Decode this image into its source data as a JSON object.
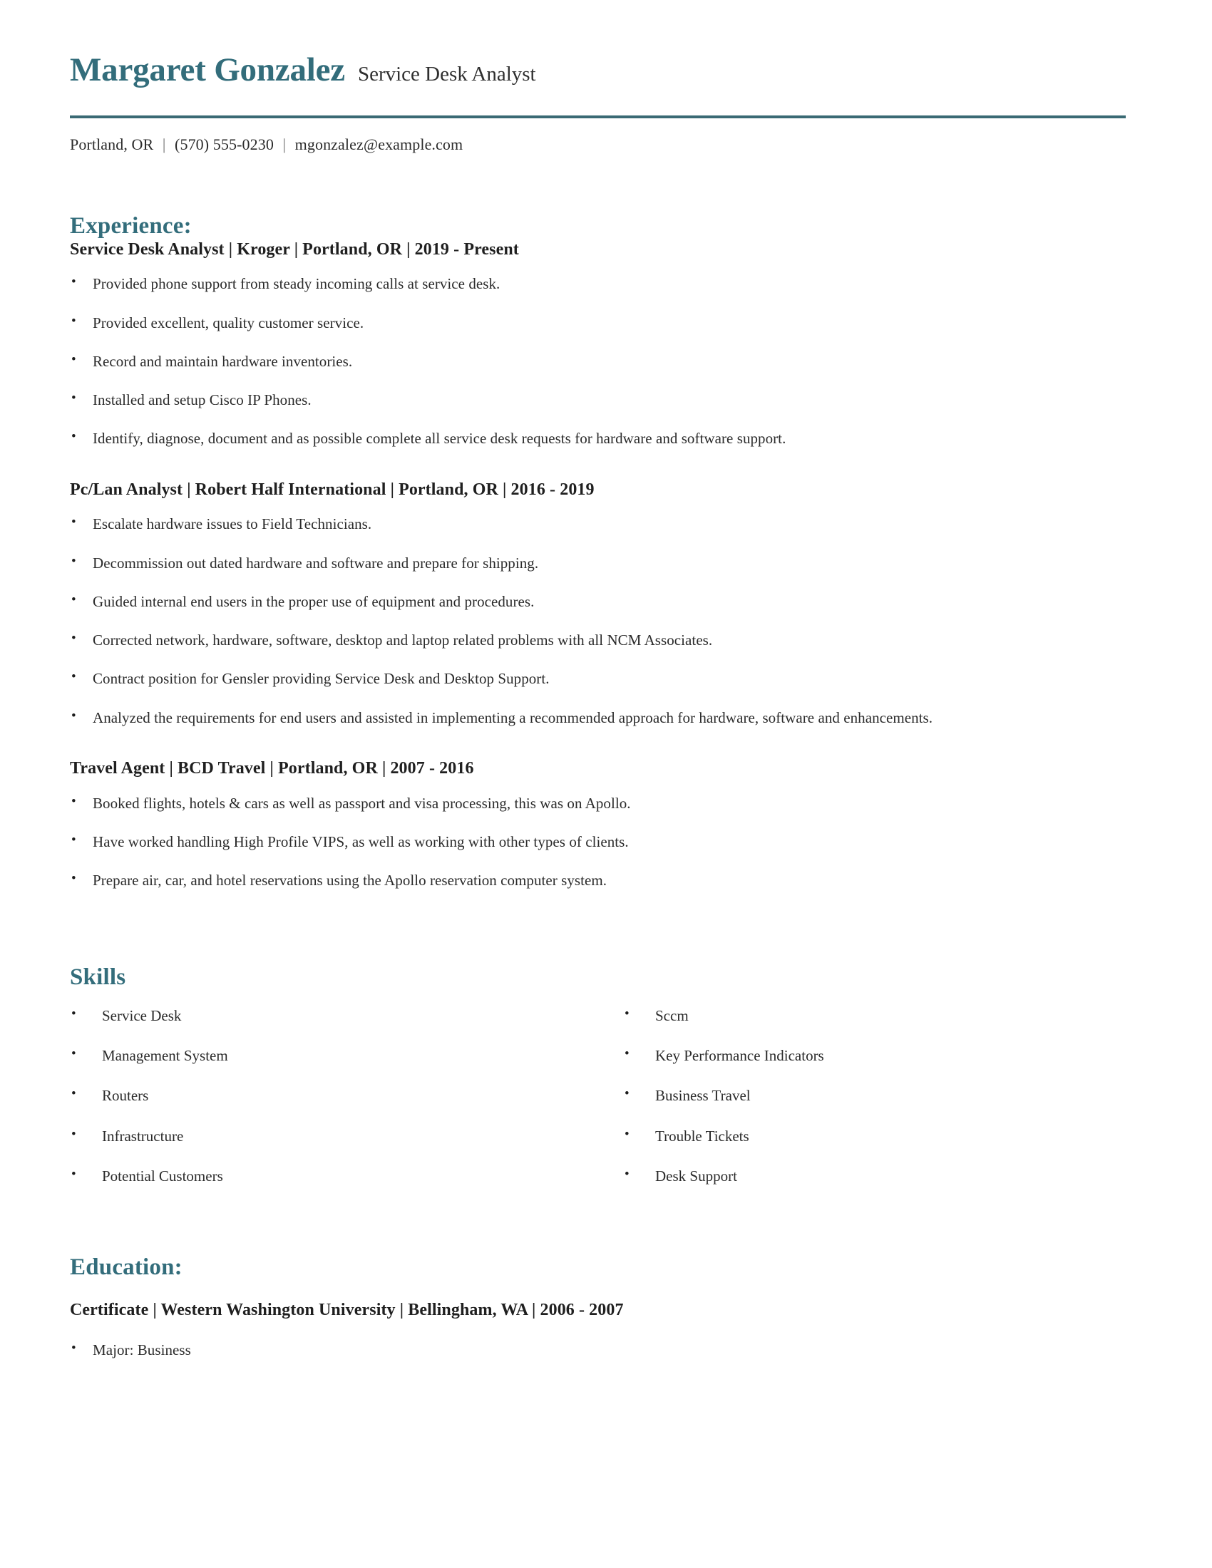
{
  "theme": {
    "accent_color": "#336d7b",
    "rule_color": "#3a6a74",
    "text_color": "#2b2b2b",
    "heading_color": "#1f1f1f",
    "page_background": "#ffffff"
  },
  "header": {
    "name": "Margaret Gonzalez",
    "job_title": "Service Desk Analyst"
  },
  "contact": {
    "location": "Portland, OR",
    "separator": "|",
    "phone": "(570) 555-0230",
    "email": "mgonzalez@example.com"
  },
  "experience": {
    "title": "Experience:",
    "jobs": [
      {
        "heading": "Service Desk Analyst | Kroger | Portland, OR | 2019 - Present",
        "role": "Service Desk Analyst",
        "company": "Kroger",
        "location": "Portland, OR",
        "dates": "2019 - Present",
        "bullets": [
          "Provided phone support from steady incoming calls at service desk.",
          "Provided excellent, quality customer service.",
          "Record and maintain hardware inventories.",
          "Installed and setup Cisco IP Phones.",
          "Identify, diagnose, document and as possible complete all service desk requests for hardware and software support."
        ]
      },
      {
        "heading": "Pc/Lan Analyst | Robert Half International | Portland, OR | 2016 - 2019",
        "role": "Pc/Lan Analyst",
        "company": "Robert Half International",
        "location": "Portland, OR",
        "dates": "2016 - 2019",
        "bullets": [
          "Escalate hardware issues to Field Technicians.",
          "Decommission out dated hardware and software and prepare for shipping.",
          "Guided internal end users in the proper use of equipment and procedures.",
          "Corrected network, hardware, software, desktop and laptop related problems with all NCM Associates.",
          "Contract position for Gensler providing Service Desk and Desktop Support.",
          "Analyzed the requirements for end users and assisted in implementing a recommended approach for hardware, software and enhancements."
        ]
      },
      {
        "heading": "Travel Agent | BCD Travel | Portland, OR | 2007 - 2016",
        "role": "Travel Agent",
        "company": "BCD Travel",
        "location": "Portland, OR",
        "dates": "2007 - 2016",
        "bullets": [
          "Booked flights, hotels & cars as well as passport and visa processing, this was on Apollo.",
          "Have worked handling High Profile VIPS, as well as working with other types of clients.",
          "Prepare air, car, and hotel reservations using the Apollo reservation computer system."
        ]
      }
    ]
  },
  "skills": {
    "title": "Skills",
    "left_column": [
      "Service Desk",
      "Management System",
      "Routers",
      "Infrastructure",
      "Potential Customers"
    ],
    "right_column": [
      "Sccm",
      "Key Performance Indicators",
      "Business Travel",
      "Trouble Tickets",
      "Desk Support"
    ]
  },
  "education": {
    "title": "Education:",
    "entries": [
      {
        "heading": "Certificate | Western Washington University | Bellingham, WA | 2006 - 2007",
        "credential": "Certificate",
        "school": "Western Washington University",
        "location": "Bellingham, WA",
        "dates": "2006 - 2007",
        "bullets": [
          "Major: Business"
        ]
      }
    ]
  }
}
